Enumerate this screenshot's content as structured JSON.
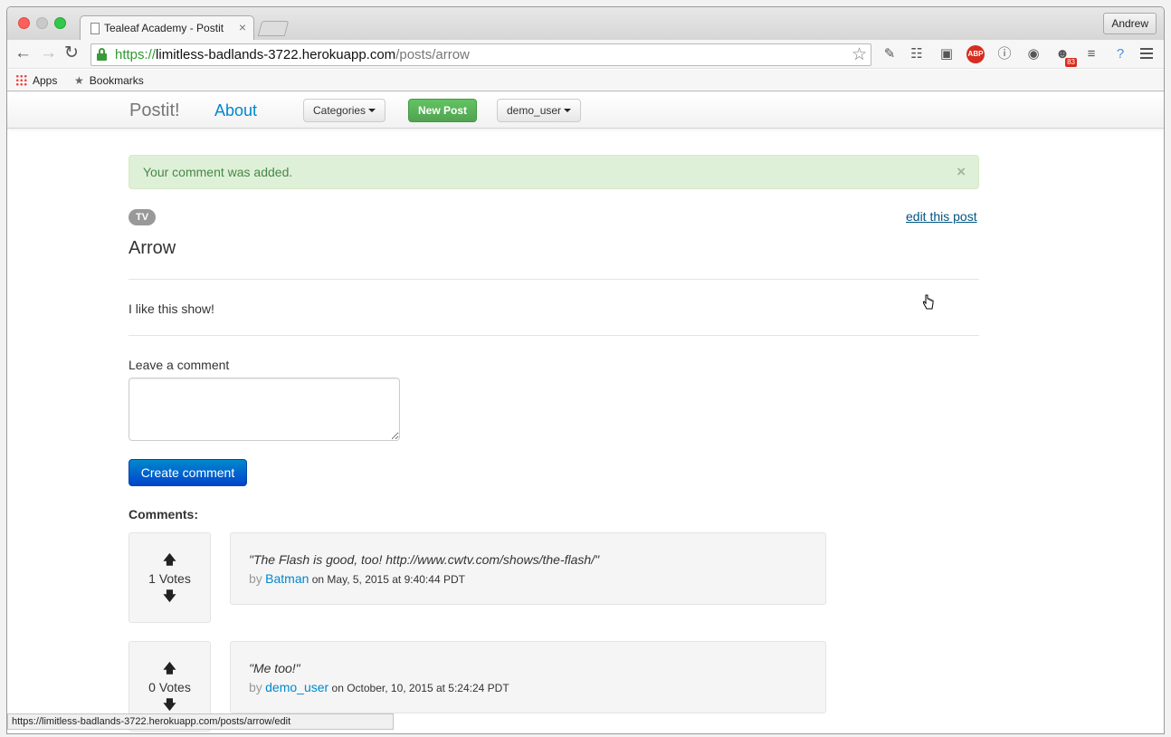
{
  "browser": {
    "tab_title": "Tealeaf Academy - Postit",
    "tab_close": "×",
    "profile_name": "Andrew",
    "url_scheme": "https://",
    "url_host": "limitless-badlands-3722.herokuapp.com",
    "url_path": "/posts/arrow",
    "bookmarks": [
      {
        "label": "Apps",
        "icon": "apps-grid-icon"
      },
      {
        "label": "Bookmarks",
        "icon": "star-icon"
      }
    ],
    "extension_badge": "83",
    "extension_abp": "ABP",
    "status_url": "https://limitless-badlands-3722.herokuapp.com/posts/arrow/edit"
  },
  "navbar": {
    "brand": "Postit!",
    "about": "About",
    "categories": "Categories",
    "new_post": "New Post",
    "user": "demo_user"
  },
  "alert": {
    "message": "Your comment was added.",
    "close": "×",
    "color": "#dff0d8"
  },
  "post": {
    "category": "TV",
    "edit_link": "edit this post",
    "title": "Arrow",
    "body": "I like this show!"
  },
  "comment_form": {
    "label": "Leave a comment",
    "value": "",
    "submit": "Create comment"
  },
  "comments": {
    "heading": "Comments:",
    "items": [
      {
        "votes": "1 Votes",
        "text": "\"The Flash is good, too! http://www.cwtv.com/shows/the-flash/\"",
        "by": "by",
        "author": "Batman",
        "timestamp": "on May, 5, 2015 at 9:40:44 PDT"
      },
      {
        "votes": "0 Votes",
        "text": "\"Me too!\"",
        "by": "by",
        "author": "demo_user",
        "timestamp": "on October, 10, 2015 at 5:24:24 PDT"
      }
    ]
  },
  "colors": {
    "link": "#0088cc",
    "success": "#51a351",
    "primary": "#0044cc"
  }
}
